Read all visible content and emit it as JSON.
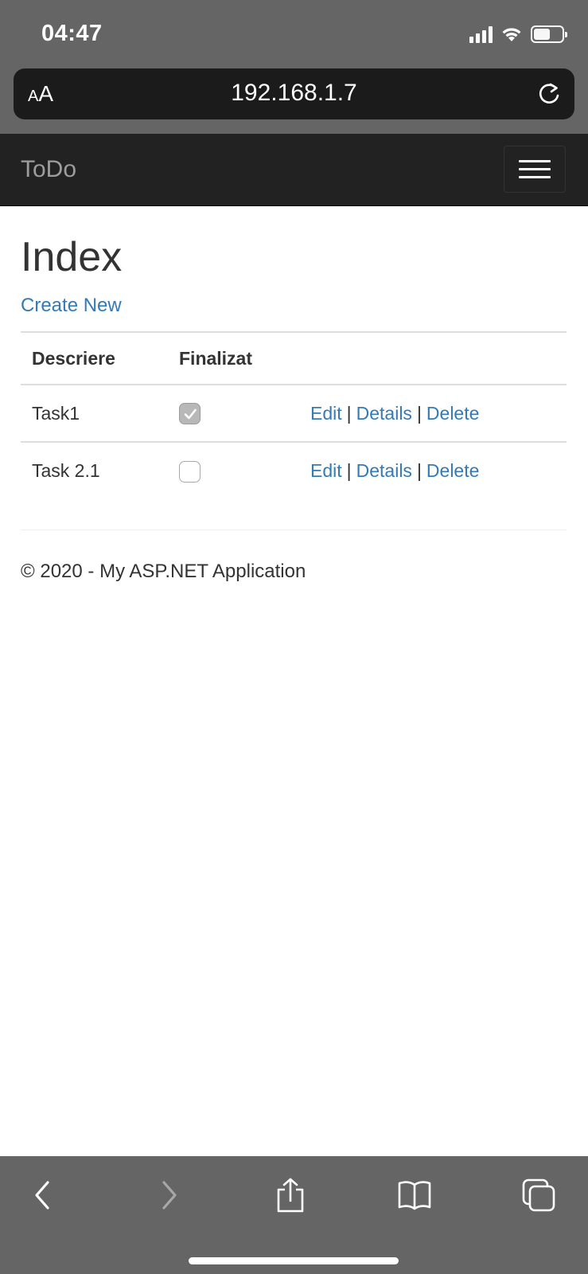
{
  "status_bar": {
    "time": "04:47",
    "icons": [
      "signal-icon",
      "wifi-icon",
      "battery-icon"
    ]
  },
  "browser": {
    "text_size_label_small": "A",
    "text_size_label_large": "A",
    "url": "192.168.1.7",
    "reload_icon": "reload-icon"
  },
  "navbar": {
    "brand": "ToDo",
    "menu_icon": "hamburger-icon"
  },
  "page": {
    "title": "Index",
    "create_link": "Create New"
  },
  "table": {
    "headers": [
      "Descriere",
      "Finalizat"
    ],
    "rows": [
      {
        "descriere": "Task1",
        "finalizat": true,
        "actions": [
          "Edit",
          "Details",
          "Delete"
        ]
      },
      {
        "descriere": "Task 2.1",
        "finalizat": false,
        "actions": [
          "Edit",
          "Details",
          "Delete"
        ]
      }
    ],
    "separator": "|"
  },
  "footer": {
    "text": "© 2020 - My ASP.NET Application"
  },
  "toolbar": {
    "items": [
      "back-icon",
      "forward-icon",
      "share-icon",
      "bookmarks-icon",
      "tabs-icon"
    ]
  },
  "colors": {
    "link": "#337ab7",
    "navbar_bg": "#222222",
    "browser_chrome": "#656565",
    "brand_text": "#9d9d9d"
  }
}
